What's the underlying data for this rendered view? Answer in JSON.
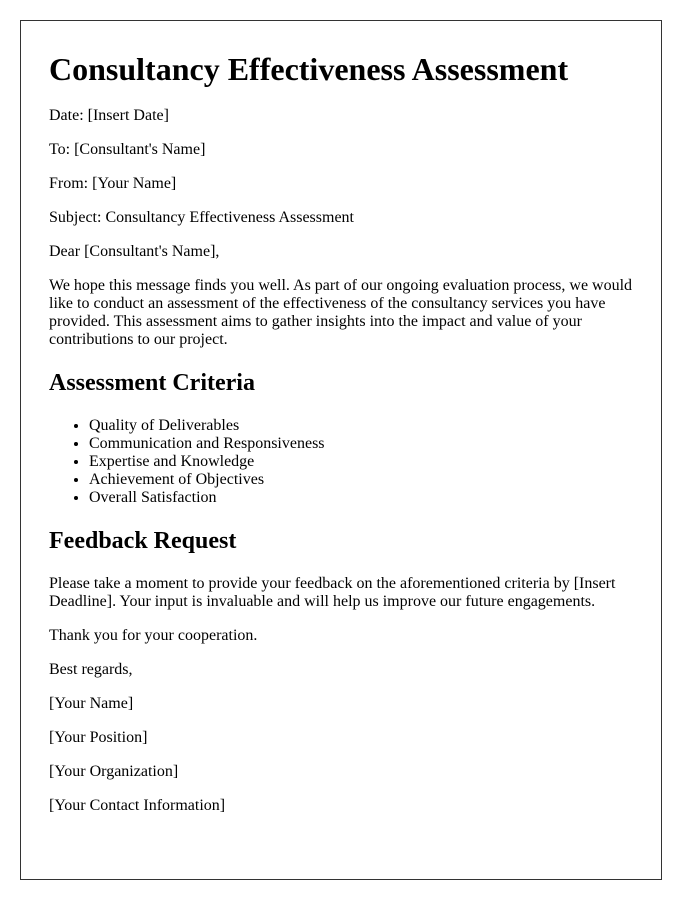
{
  "title": "Consultancy Effectiveness Assessment",
  "header_fields": {
    "date": "Date: [Insert Date]",
    "to": "To: [Consultant's Name]",
    "from": "From: [Your Name]",
    "subject": "Subject: Consultancy Effectiveness Assessment"
  },
  "salutation": "Dear [Consultant's Name],",
  "intro": "We hope this message finds you well. As part of our ongoing evaluation process, we would like to conduct an assessment of the effectiveness of the consultancy services you have provided. This assessment aims to gather insights into the impact and value of your contributions to our project.",
  "criteria": {
    "heading": "Assessment Criteria",
    "items": [
      "Quality of Deliverables",
      "Communication and Responsiveness",
      "Expertise and Knowledge",
      "Achievement of Objectives",
      "Overall Satisfaction"
    ]
  },
  "feedback": {
    "heading": "Feedback Request",
    "body": "Please take a moment to provide your feedback on the aforementioned criteria by [Insert Deadline]. Your input is invaluable and will help us improve our future engagements.",
    "thanks": "Thank you for your cooperation."
  },
  "signature": {
    "closing": "Best regards,",
    "name": "[Your Name]",
    "position": "[Your Position]",
    "organization": "[Your Organization]",
    "contact": "[Your Contact Information]"
  }
}
